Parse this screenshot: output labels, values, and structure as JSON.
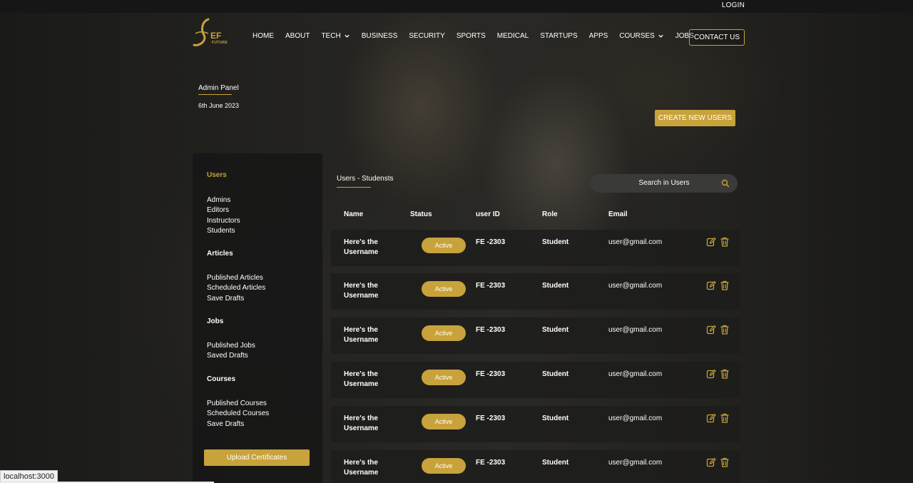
{
  "header": {
    "login_label": "LOGIN",
    "logo": {
      "mark": "EF",
      "sub": "FUTURE"
    },
    "nav": [
      {
        "label": "HOME"
      },
      {
        "label": "ABOUT"
      },
      {
        "label": "TECH",
        "has_dropdown": true
      },
      {
        "label": "BUSINESS"
      },
      {
        "label": "SECURITY"
      },
      {
        "label": "SPORTS"
      },
      {
        "label": "MEDICAL"
      },
      {
        "label": "STARTUPS"
      },
      {
        "label": "APPS"
      },
      {
        "label": "COURSES",
        "has_dropdown": true
      },
      {
        "label": "JOBS"
      }
    ],
    "contact_label": "CONTACT US"
  },
  "admin": {
    "title": "Admin Panel",
    "date": "6th June 2023",
    "create_button": "CREATE NEW USERS"
  },
  "sidebar": {
    "groups": [
      {
        "heading": "Users",
        "active": true,
        "items": [
          "Admins",
          "Editors",
          "Instructors",
          "Students"
        ]
      },
      {
        "heading": "Articles",
        "items": [
          "Published Articles",
          "Scheduled Articles",
          "Save Drafts"
        ]
      },
      {
        "heading": "Jobs",
        "items": [
          "Published Jobs",
          "Saved Drafts"
        ]
      },
      {
        "heading": "Courses",
        "items": [
          "Published Courses",
          "Scheduled Courses",
          "Save Drafts"
        ]
      }
    ],
    "upload_button": "Upload Certificates"
  },
  "main": {
    "title": "Users - Studensts",
    "search_placeholder": "Search in Users",
    "columns": [
      "Name",
      "Status",
      "user ID",
      "Role",
      "Email"
    ],
    "rows": [
      {
        "name_line1": "Here's the",
        "name_line2": "Username",
        "status": "Active",
        "id": "FE -2303",
        "role": "Student",
        "email": "user@gmail.com"
      },
      {
        "name_line1": "Here's the",
        "name_line2": "Username",
        "status": "Active",
        "id": "FE -2303",
        "role": "Student",
        "email": "user@gmail.com"
      },
      {
        "name_line1": "Here's the",
        "name_line2": "Username",
        "status": "Active",
        "id": "FE -2303",
        "role": "Student",
        "email": "user@gmail.com"
      },
      {
        "name_line1": "Here's the",
        "name_line2": "Username",
        "status": "Active",
        "id": "FE -2303",
        "role": "Student",
        "email": "user@gmail.com"
      },
      {
        "name_line1": "Here's the",
        "name_line2": "Username",
        "status": "Active",
        "id": "FE -2303",
        "role": "Student",
        "email": "user@gmail.com"
      },
      {
        "name_line1": "Here's the",
        "name_line2": "Username",
        "status": "Active",
        "id": "FE -2303",
        "role": "Student",
        "email": "user@gmail.com"
      }
    ]
  },
  "browser": {
    "status_url": "localhost:3000"
  },
  "colors": {
    "accent": "#c8a23a",
    "background": "#1b1b19"
  }
}
